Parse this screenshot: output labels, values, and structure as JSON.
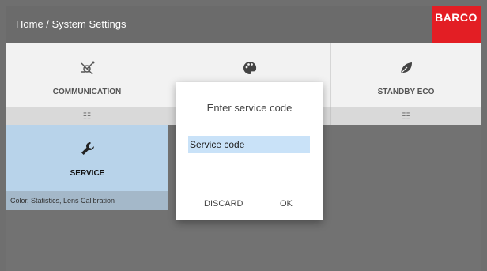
{
  "header": {
    "breadcrumb": "Home / System Settings",
    "logo": "BARCO",
    "logo_color": "#e31e24"
  },
  "tiles": [
    {
      "label": "COMMUNICATION",
      "icon": "satellite-dish-icon",
      "settings_icon": "sliders-icon"
    },
    {
      "label": "",
      "icon": "palette-icon",
      "settings_icon": "sliders-icon"
    },
    {
      "label": "STANDBY ECO",
      "icon": "leaf-icon",
      "settings_icon": "sliders-icon"
    }
  ],
  "service": {
    "label": "SERVICE",
    "icon": "wrench-icon",
    "description": "Color, Statistics, Lens Calibration",
    "color": "#b8d3ea"
  },
  "dialog": {
    "title": "Enter service code",
    "input_placeholder": "Service code",
    "discard_label": "DISCARD",
    "ok_label": "OK"
  },
  "glyphs": {
    "sliders": "☷",
    "satellite": "⚙",
    "palette": "◉",
    "leaf": "❦",
    "wrench": "🔧"
  }
}
